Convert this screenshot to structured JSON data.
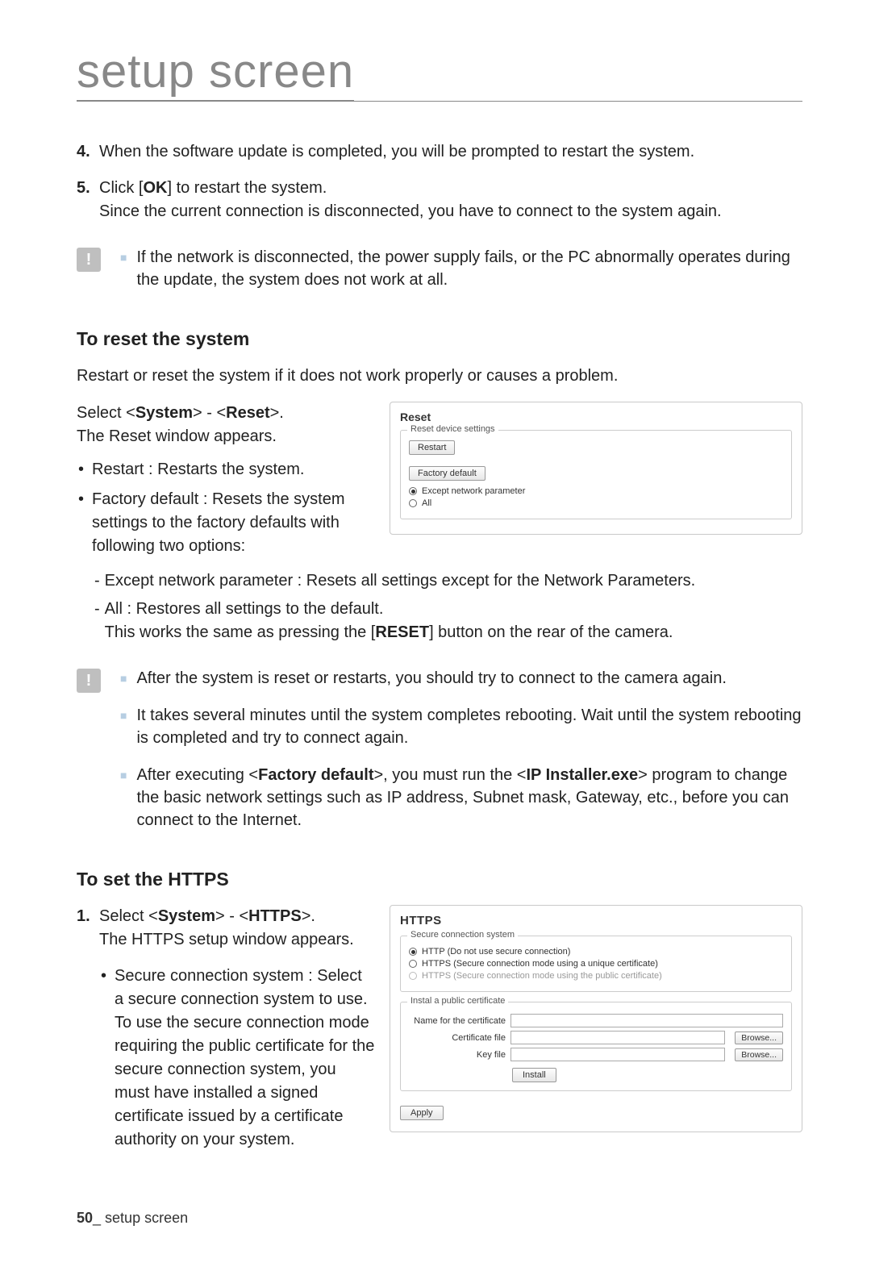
{
  "pageTitle": "setup screen",
  "step4": {
    "num": "4.",
    "text": "When the software update is completed, you will be prompted to restart the system."
  },
  "step5": {
    "num": "5.",
    "pre": "Click [",
    "bold": "OK",
    "post": "] to restart the system.",
    "line2": "Since the current connection is disconnected, you have to connect to the system again."
  },
  "caution1": {
    "text": "If the network is disconnected, the power supply fails, or the PC abnormally operates during the update, the system does not work at all."
  },
  "resetHeading": "To reset the system",
  "resetIntro": "Restart or reset the system if it does not work properly or causes a problem.",
  "sel1_pre": "Select <",
  "sel1_b1": "System",
  "sel1_mid": "> - <",
  "sel1_b2": "Reset",
  "sel1_post": ">.",
  "sel1_line2": "The Reset window appears.",
  "bullet_restart": "Restart : Restarts the system.",
  "bullet_factory": "Factory default : Resets the system settings to the factory defaults with following two options:",
  "dash_except": "Except network parameter : Resets all settings except for the Network Parameters.",
  "dash_all_l1": "All : Restores all settings to the default.",
  "dash_all_l2_pre": "This works the same as pressing the [",
  "dash_all_l2_b": "RESET",
  "dash_all_l2_post": "] button on the rear of the camera.",
  "caution2a": "After the system is reset or restarts, you should try to connect to the camera again.",
  "caution2b": "It takes several minutes until the system completes rebooting. Wait until the system rebooting is completed and try to connect again.",
  "caution2c_pre": "After executing <",
  "caution2c_b1": "Factory default",
  "caution2c_mid": ">, you must run the <",
  "caution2c_b2": "IP Installer.exe",
  "caution2c_post": "> program to change the basic network settings such as IP address, Subnet mask, Gateway, etc., before you can connect to the Internet.",
  "httpsHeading": "To set the HTTPS",
  "https_step1": {
    "num": "1.",
    "pre": "Select <",
    "b1": "System",
    "mid": "> - <",
    "b2": "HTTPS",
    "post": ">.",
    "line2": "The HTTPS setup window appears."
  },
  "https_bullet": "Secure connection system : Select a secure connection system to use. To use the secure connection mode requiring the public certificate for the secure connection system, you must have installed a signed certificate issued by a certificate authority on your system.",
  "resetPanel": {
    "title": "Reset",
    "legend1": "Reset device settings",
    "restartBtn": "Restart",
    "factoryBtn": "Factory default",
    "opt1": "Except network parameter",
    "opt2": "All"
  },
  "httpsPanel": {
    "title": "HTTPS",
    "legend1": "Secure connection system",
    "r1": "HTTP   (Do not use secure connection)",
    "r2": "HTTPS (Secure connection mode using a unique certificate)",
    "r3": "HTTPS (Secure connection mode using the public certificate)",
    "legend2": "Instal a public certificate",
    "lbl1": "Name for the certificate",
    "lbl2": "Certificate file",
    "lbl3": "Key file",
    "browse": "Browse...",
    "install": "Install",
    "apply": "Apply"
  },
  "footer": {
    "page": "50",
    "sep": "_ ",
    "label": "setup screen"
  }
}
